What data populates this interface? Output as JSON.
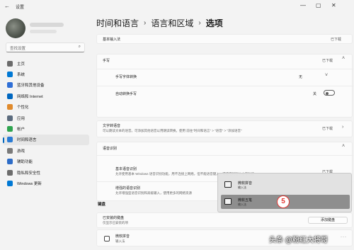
{
  "window": {
    "app_name": "设置",
    "back_icon": "back-arrow-icon",
    "controls": [
      "—",
      "▢",
      "✕"
    ]
  },
  "sidebar": {
    "search_placeholder": "查找设置",
    "items": [
      {
        "label": "主页",
        "icon": "home-icon",
        "color": "#6b6b6b"
      },
      {
        "label": "系统",
        "icon": "monitor-icon",
        "color": "#0078d4"
      },
      {
        "label": "蓝牙和其他设备",
        "icon": "bluetooth-icon",
        "color": "#2f6fd6"
      },
      {
        "label": "网络和 Internet",
        "icon": "wifi-icon",
        "color": "#0067c0"
      },
      {
        "label": "个性化",
        "icon": "brush-icon",
        "color": "#e08a2b"
      },
      {
        "label": "应用",
        "icon": "apps-icon",
        "color": "#5b6b7d"
      },
      {
        "label": "帐户",
        "icon": "account-icon",
        "color": "#2fa44f"
      },
      {
        "label": "时间和语言",
        "icon": "globe-clock-icon",
        "color": "#2a7bd4",
        "active": true
      },
      {
        "label": "游戏",
        "icon": "gamepad-icon",
        "color": "#7a7a7a"
      },
      {
        "label": "辅助功能",
        "icon": "accessibility-icon",
        "color": "#2d6cc7"
      },
      {
        "label": "隐私和安全性",
        "icon": "shield-icon",
        "color": "#6c6c6c"
      },
      {
        "label": "Windows 更新",
        "icon": "update-icon",
        "color": "#0078d4"
      }
    ]
  },
  "main": {
    "breadcrumb": [
      "时间和语言",
      "语言和区域",
      "选项"
    ],
    "basic_ime": {
      "label": "基本输入法",
      "link": "已下载"
    },
    "handwriting": {
      "header": "手写",
      "header_link": "已下载",
      "pen_label": "手写字体转换",
      "pen_value": "无",
      "auto_label": "自动转换手写",
      "auto_state": "关"
    },
    "text_to_speech": {
      "title": "文字转语音",
      "desc": "可以朗读文本的语音。可添加其他语音以用朗读转换。使用 前往\"时间和语言\" > \"语音\" > \"添加语音\"",
      "link": "已下载"
    },
    "speech": {
      "header": "语音识别",
      "basic_title": "基本语音识别",
      "basic_desc": "允许使用基本 Windows 语音识别功能，用不连接上网络，但不能语音键入，或使用听写文本等功能",
      "basic_link": "已下载",
      "enhanced_title": "增强的语音识别",
      "enhanced_desc": "允许增强型语音识别和高级输入，使用更多的网络资源"
    },
    "keyboards": {
      "header": "键盘",
      "installed_label": "已安装的键盘",
      "installed_sub": "仅显示已安装的项",
      "add_button": "添加键盘",
      "ms_pinyin": "微软拼音",
      "ms_pinyin_sub": "输入法"
    }
  },
  "popup": {
    "items": [
      {
        "name": "微软拼音",
        "sub": "输入法"
      },
      {
        "name": "微软五笔",
        "sub": "输入法"
      }
    ],
    "step_badge": "5"
  },
  "watermark": "头条 @粉红大将哥"
}
